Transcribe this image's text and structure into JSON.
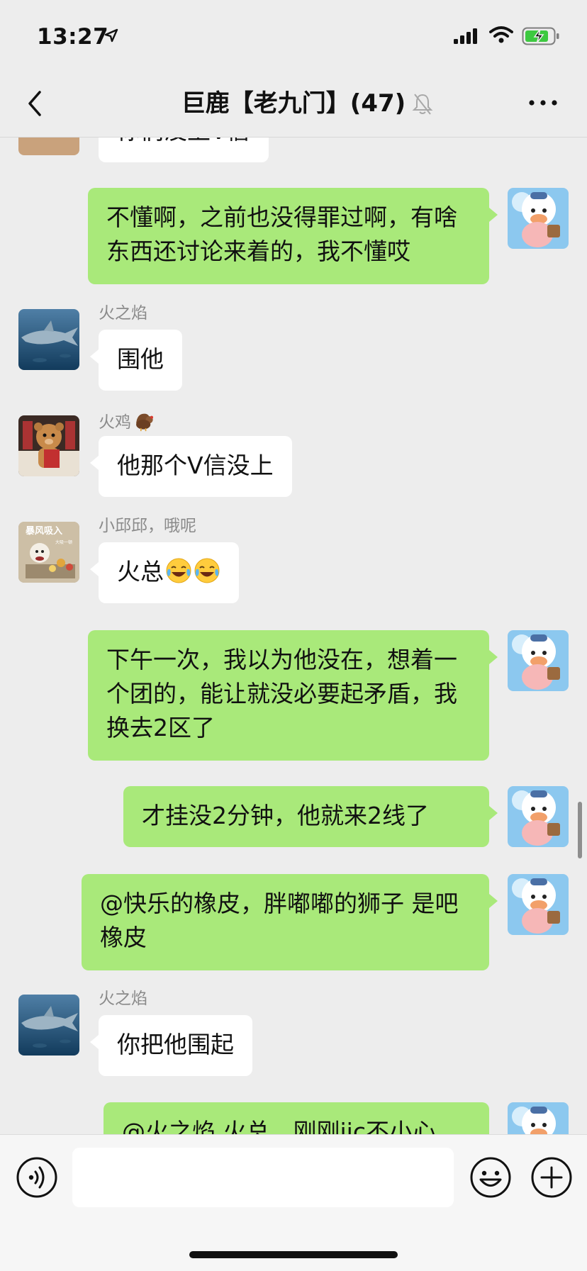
{
  "status_bar": {
    "time": "13:27"
  },
  "header": {
    "title": "巨鹿【老九门】(47)"
  },
  "messages": [
    {
      "text": "你们没上V信"
    },
    {
      "text": "不懂啊，之前也没得罪过啊，有啥东西还讨论来着的，我不懂哎"
    },
    {
      "sender": "火之焰",
      "text": "围他"
    },
    {
      "sender": "火鸡",
      "text": "他那个V信没上"
    },
    {
      "sender": "小邱邱，哦呢",
      "text": "火总"
    },
    {
      "text": "下午一次，我以为他没在，想着一个团的，能让就没必要起矛盾，我换去2区了"
    },
    {
      "text": "才挂没2分钟，他就来2线了"
    },
    {
      "text": "@快乐的橡皮，胖嘟嘟的狮子 是吧橡皮"
    },
    {
      "sender": "火之焰",
      "text": "你把他围起"
    },
    {
      "text": "@火之焰 火总，刚刚jjc不小心"
    }
  ],
  "avatar_caption": {
    "line1": "暴风吸入",
    "line2": "大吸一顿"
  },
  "input": {
    "placeholder": ""
  },
  "icons": [
    "location-arrow-icon",
    "signal-icon",
    "wifi-icon",
    "battery-icon",
    "back-icon",
    "mute-bell-icon",
    "more-icon",
    "voice-icon",
    "emoji-face-icon",
    "plus-icon",
    "laugh-cry-emoji-icon",
    "turkey-emoji-icon"
  ],
  "colors": {
    "background": "#ededed",
    "outgoing_bubble": "#a9e97a",
    "incoming_bubble": "#ffffff",
    "sender_name": "#8a8a8a"
  }
}
